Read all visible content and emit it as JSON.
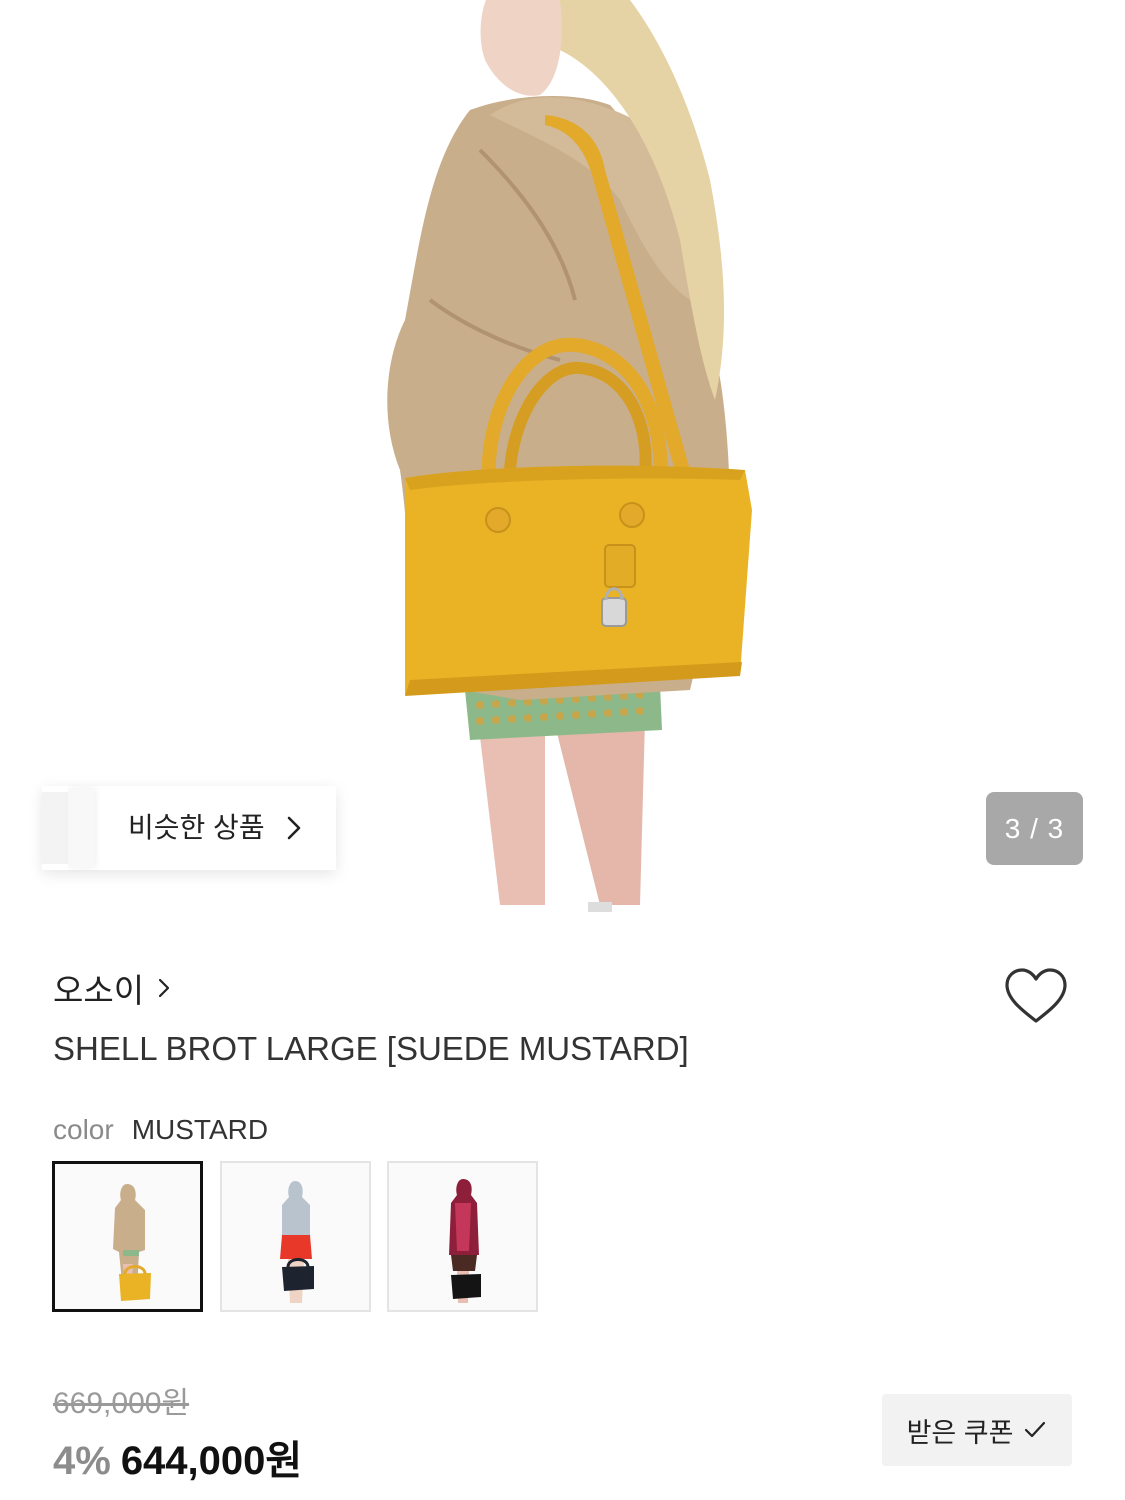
{
  "gallery": {
    "similar_label": "비슷한 상품",
    "counter": "3 / 3"
  },
  "product": {
    "brand": "오소이",
    "title": "SHELL BROT LARGE [SUEDE MUSTARD]",
    "color_key": "color",
    "color_value": "MUSTARD",
    "swatches": [
      {
        "name": "mustard",
        "selected": true
      },
      {
        "name": "red",
        "selected": false
      },
      {
        "name": "burgundy",
        "selected": false
      }
    ]
  },
  "pricing": {
    "original": "669,000원",
    "discount": "4%",
    "price": "644,000원",
    "coupon_label": "받은 쿠폰"
  },
  "icons": {
    "similar_chevron": "chevron-right-icon",
    "brand_chevron": "chevron-right-icon",
    "wishlist": "heart-outline-icon",
    "coupon_check": "check-icon"
  },
  "colors": {
    "bag": "#E9B325",
    "coat": "#C9AE8B",
    "counter_bg": "#A8A8A8"
  }
}
